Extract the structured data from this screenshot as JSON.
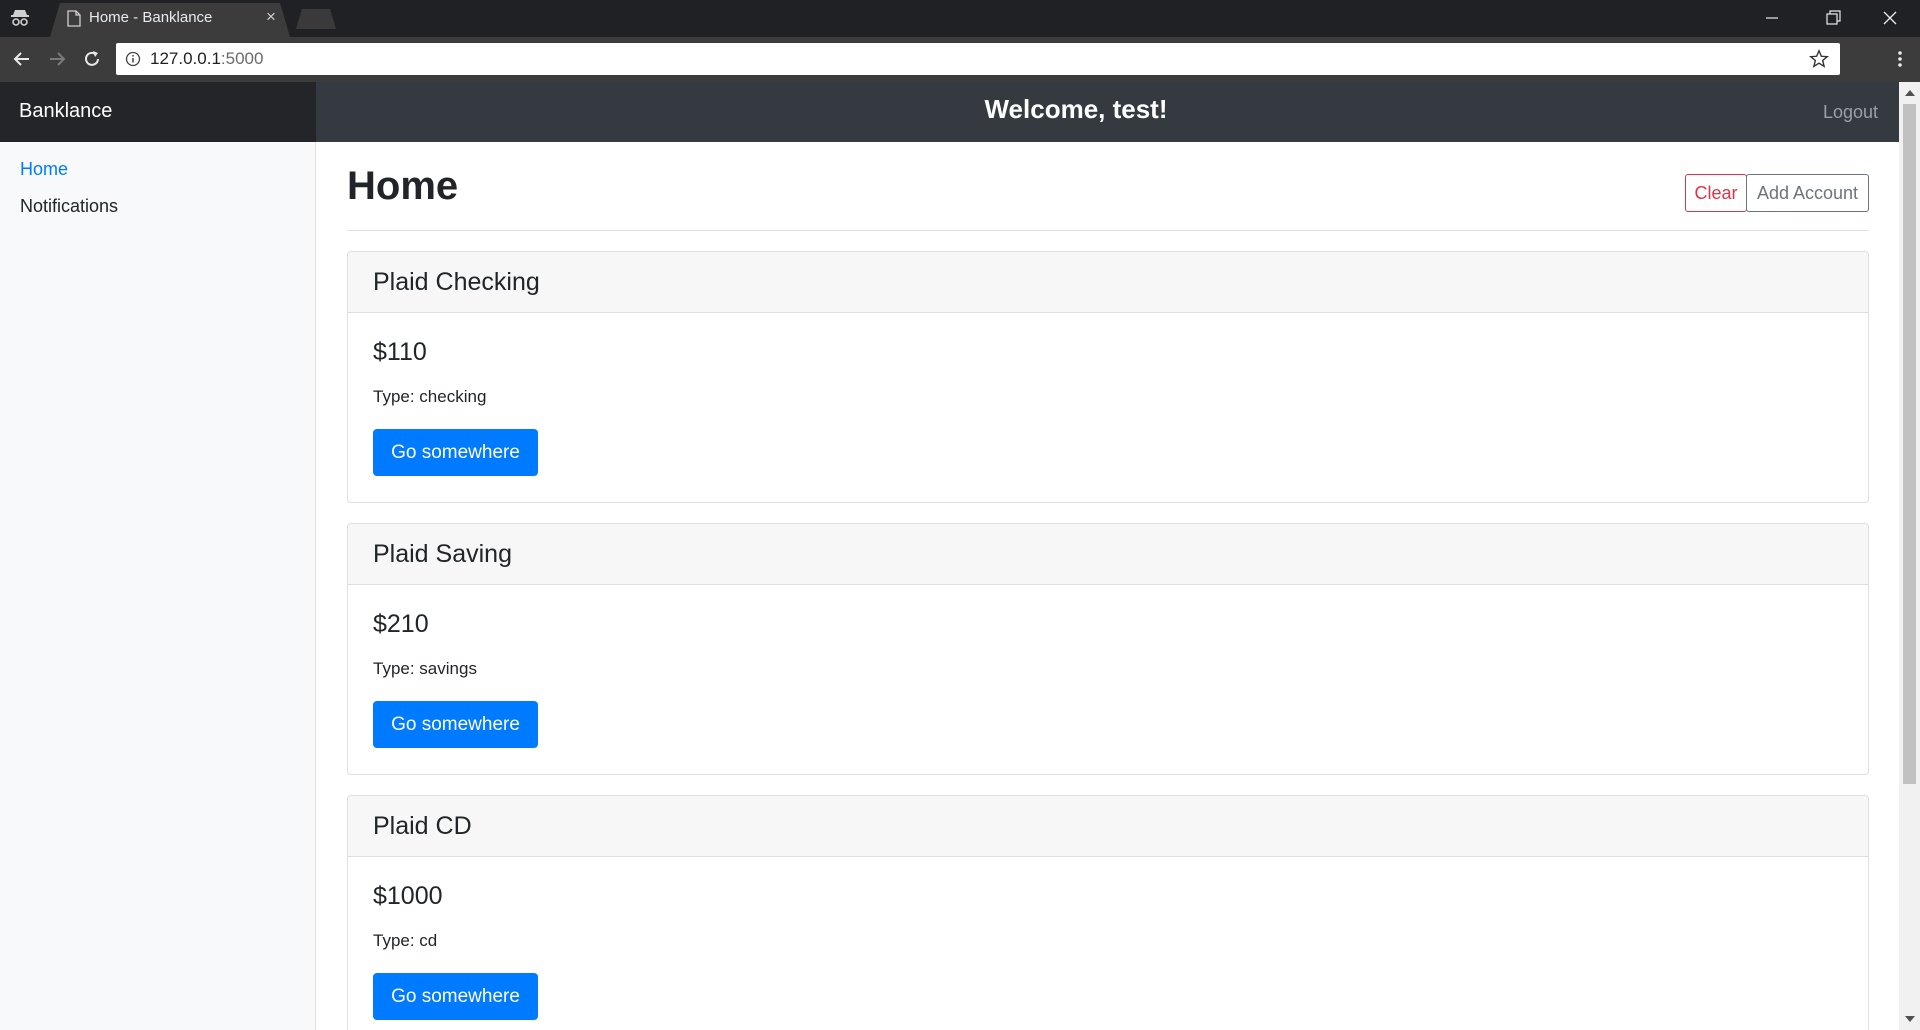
{
  "browser": {
    "tab_title": "Home - Banklance",
    "tab_close": "×",
    "url_host": "127.0.0.1",
    "url_port": ":5000"
  },
  "navbar": {
    "brand": "Banklance",
    "welcome": "Welcome, test!",
    "logout": "Logout"
  },
  "sidebar": {
    "items": [
      {
        "label": "Home",
        "active": true
      },
      {
        "label": "Notifications",
        "active": false
      }
    ]
  },
  "main": {
    "title": "Home",
    "clear_label": "Clear",
    "add_label": "Add Account",
    "accounts": [
      {
        "name": "Plaid Checking",
        "balance": "$110",
        "type": "Type: checking",
        "button": "Go somewhere"
      },
      {
        "name": "Plaid Saving",
        "balance": "$210",
        "type": "Type: savings",
        "button": "Go somewhere"
      },
      {
        "name": "Plaid CD",
        "balance": "$1000",
        "type": "Type: cd",
        "button": "Go somewhere"
      }
    ]
  },
  "colors": {
    "primary": "#007bff",
    "danger": "#dc3545",
    "secondary": "#6c757d",
    "navbar": "#343a40",
    "brand_bar": "#232528"
  }
}
